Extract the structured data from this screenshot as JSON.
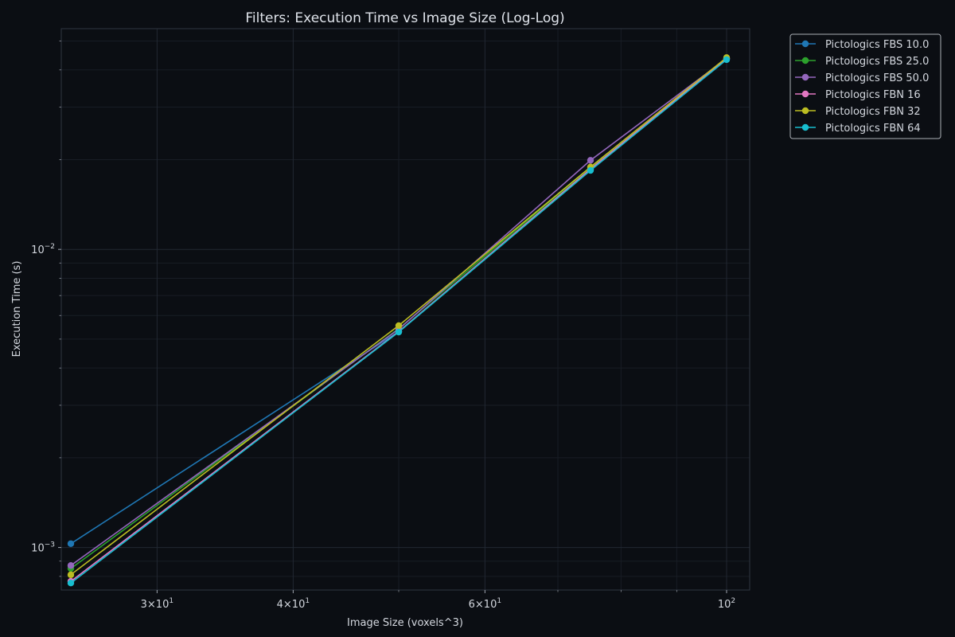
{
  "chart_data": {
    "type": "line",
    "title": "Filters: Execution Time vs Image Size (Log-Log)",
    "xlabel": "Image Size (voxels^3)",
    "ylabel": "Execution Time (s)",
    "xscale": "log",
    "yscale": "log",
    "xlim": [
      24.5,
      105
    ],
    "ylim": [
      0.00072,
      0.055
    ],
    "grid": true,
    "legend_position": "outside-top-right",
    "x_major_ticks": [
      {
        "value": 30,
        "base": "3×10",
        "exp": "1"
      },
      {
        "value": 40,
        "base": "4×10",
        "exp": "1"
      },
      {
        "value": 60,
        "base": "6×10",
        "exp": "1"
      },
      {
        "value": 100,
        "base": "10",
        "exp": "2"
      }
    ],
    "x_minor_ticks": [
      50,
      70,
      80,
      90
    ],
    "y_major_ticks": [
      {
        "value": 0.001,
        "base": "10",
        "exp": "−3"
      },
      {
        "value": 0.01,
        "base": "10",
        "exp": "−2"
      }
    ],
    "y_minor_ticks": [
      0.0008,
      0.0009,
      0.002,
      0.003,
      0.004,
      0.005,
      0.006,
      0.007,
      0.008,
      0.009,
      0.02,
      0.03,
      0.04,
      0.05
    ],
    "x": [
      25,
      50,
      75,
      100
    ],
    "series": [
      {
        "name": "Pictologics FBS 10.0",
        "color": "#1f77b4",
        "values": [
          0.00103,
          0.0053,
          0.0185,
          0.0435
        ]
      },
      {
        "name": "Pictologics FBS 25.0",
        "color": "#2ca02c",
        "values": [
          0.00085,
          0.00542,
          0.0188,
          0.0437
        ]
      },
      {
        "name": "Pictologics FBS 50.0",
        "color": "#9467bd",
        "values": [
          0.00087,
          0.0054,
          0.0199,
          0.0437
        ]
      },
      {
        "name": "Pictologics FBN 16",
        "color": "#e377c2",
        "values": [
          0.00077,
          0.0053,
          0.0186,
          0.0436
        ]
      },
      {
        "name": "Pictologics FBN 32",
        "color": "#bcbd22",
        "values": [
          0.00081,
          0.00555,
          0.0189,
          0.044
        ]
      },
      {
        "name": "Pictologics FBN 64",
        "color": "#17becf",
        "values": [
          0.00076,
          0.00528,
          0.0184,
          0.0433
        ]
      }
    ]
  }
}
